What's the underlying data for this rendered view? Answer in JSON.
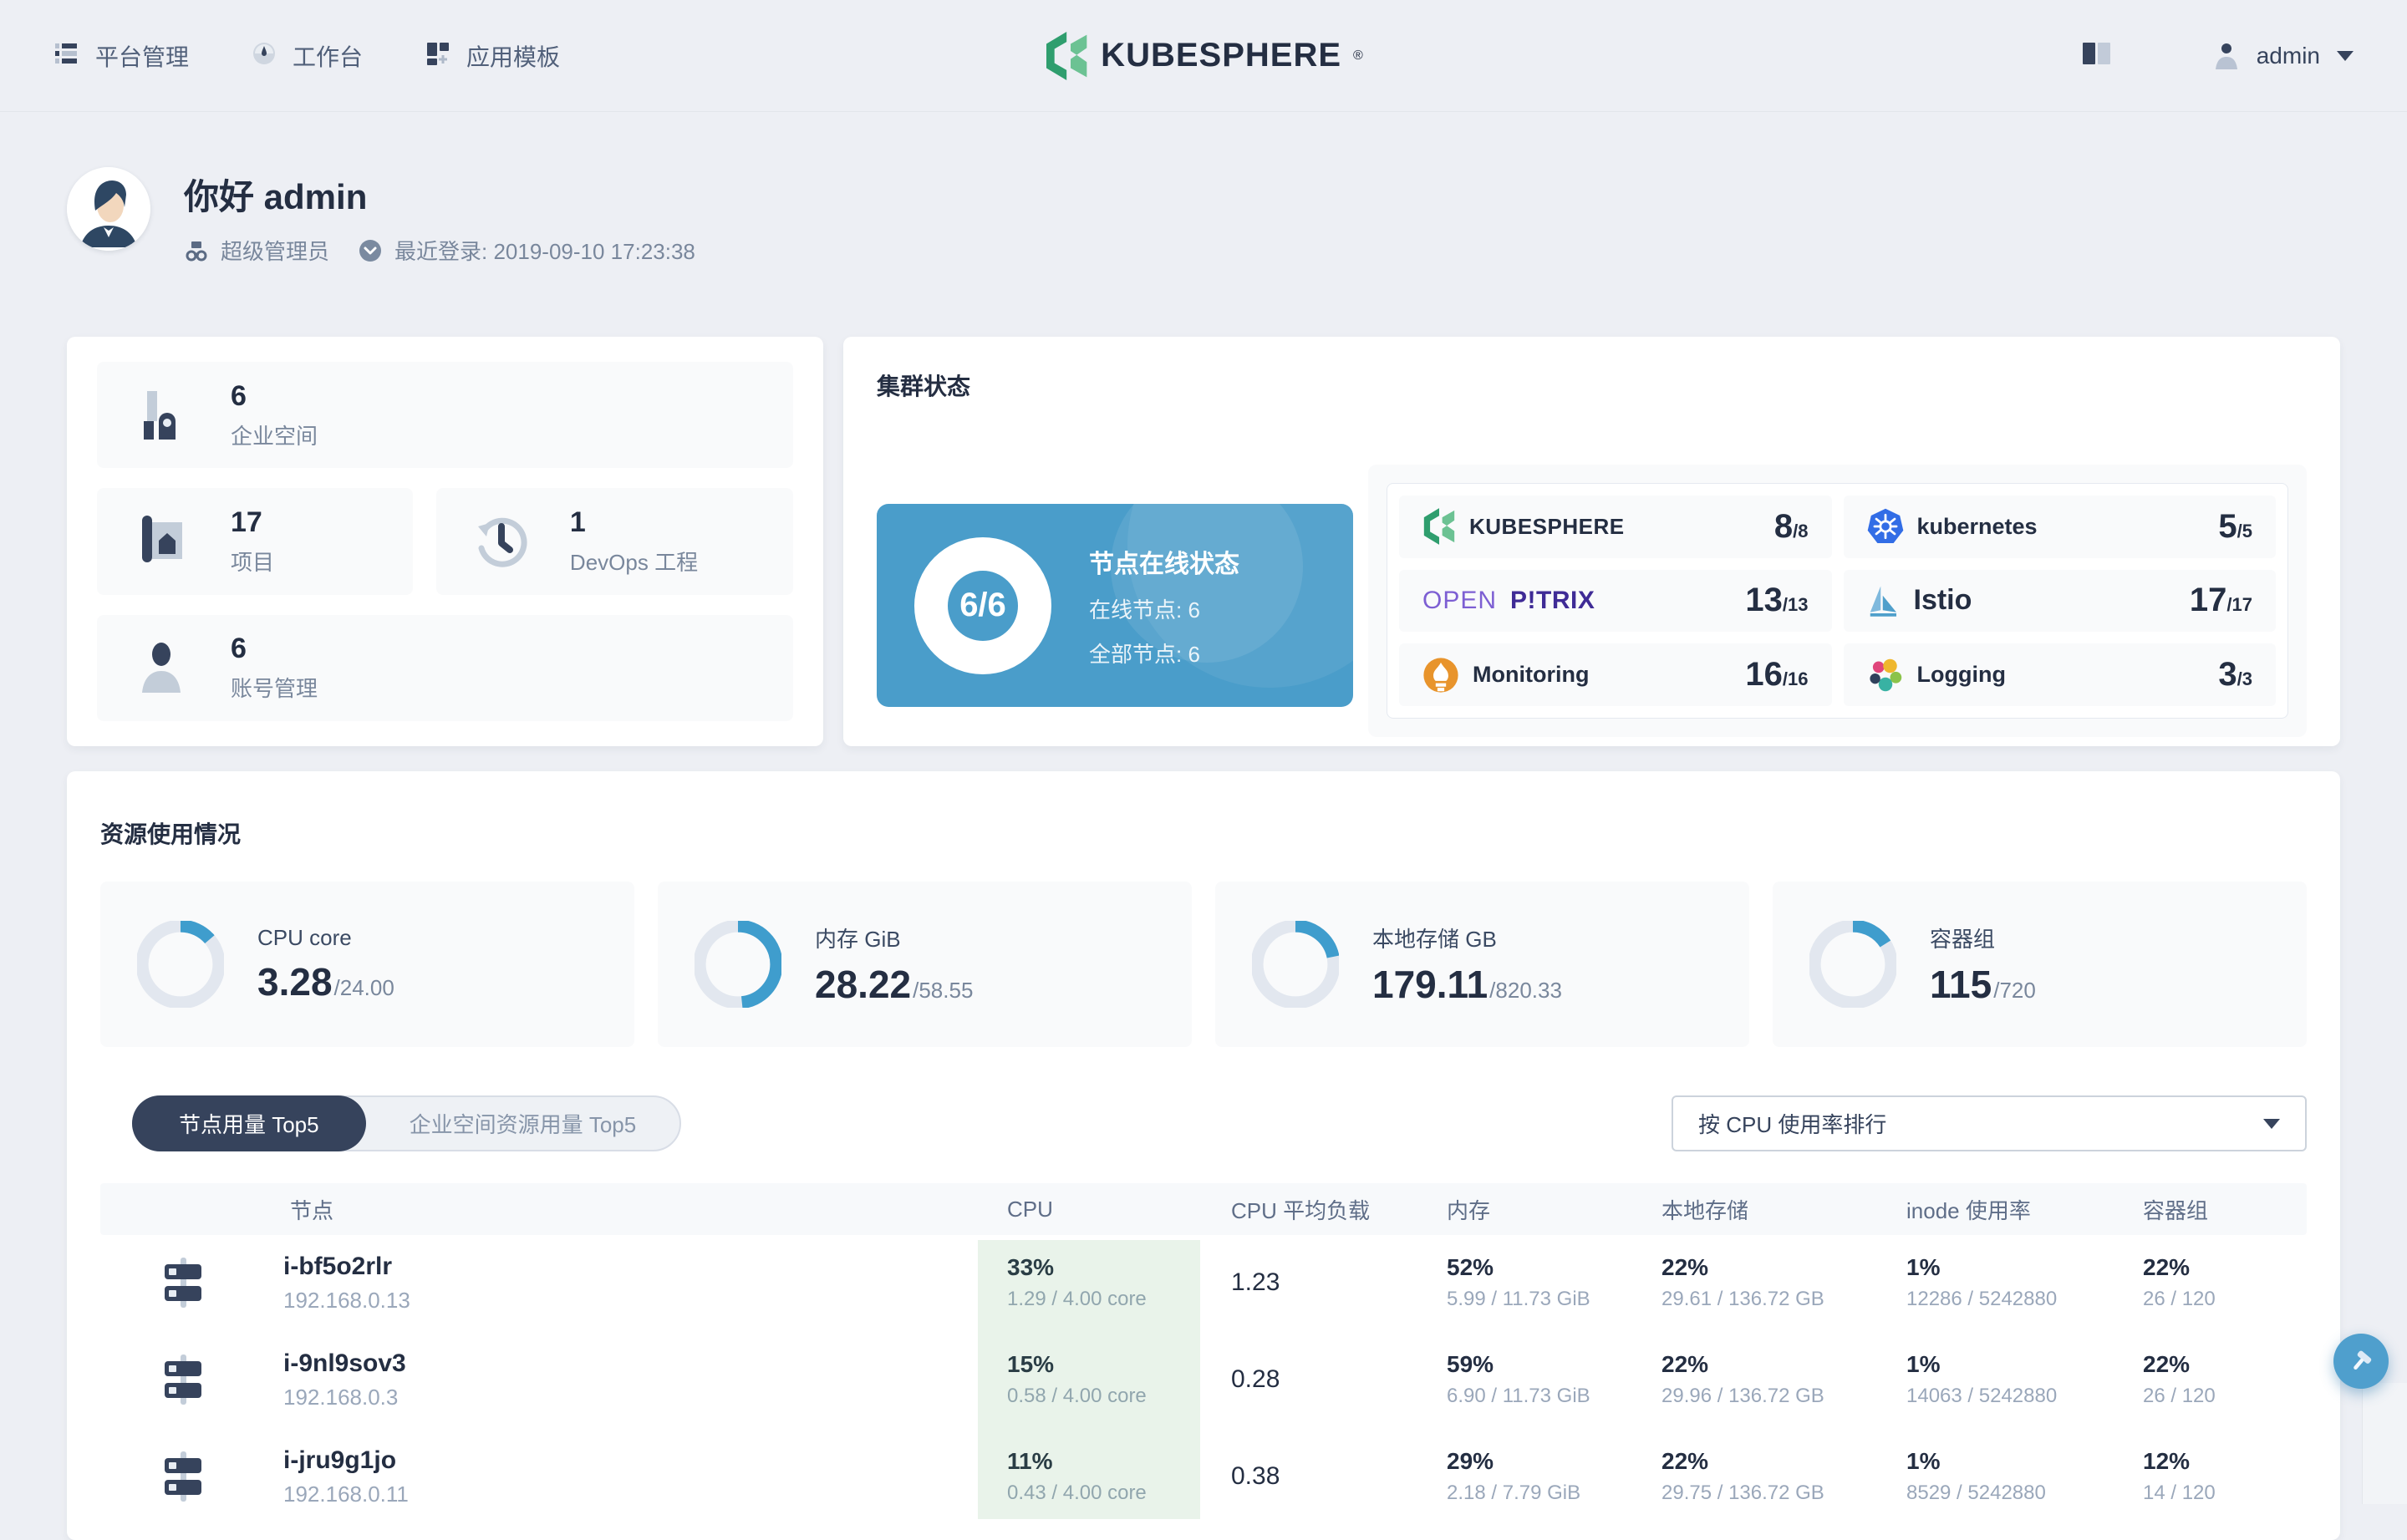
{
  "header": {
    "nav": [
      {
        "label": "平台管理"
      },
      {
        "label": "工作台"
      },
      {
        "label": "应用模板"
      }
    ],
    "logo_text": "KUBESPHERE",
    "logo_reg": "®",
    "user": "admin"
  },
  "greeting": {
    "hello": "你好 admin",
    "role": "超级管理员",
    "last_login": "最近登录: 2019-09-10 17:23:38"
  },
  "stats": {
    "workspaces": {
      "value": "6",
      "label": "企业空间"
    },
    "projects": {
      "value": "17",
      "label": "项目"
    },
    "devops": {
      "value": "1",
      "label": "DevOps 工程"
    },
    "accounts": {
      "value": "6",
      "label": "账号管理"
    }
  },
  "cluster": {
    "title": "集群状态",
    "node_card": {
      "ratio": "6/6",
      "title": "节点在线状态",
      "online": "在线节点: 6",
      "total": "全部节点: 6"
    },
    "components": [
      {
        "name": "KUBESPHERE",
        "used": "8",
        "capacity": "/8"
      },
      {
        "name": "kubernetes",
        "used": "5",
        "capacity": "/5"
      },
      {
        "name_part1": "OPEN",
        "name_part2": "P!TRIX",
        "used": "13",
        "capacity": "/13"
      },
      {
        "name": "Istio",
        "used": "17",
        "capacity": "/17"
      },
      {
        "name": "Monitoring",
        "used": "16",
        "capacity": "/16"
      },
      {
        "name": "Logging",
        "used": "3",
        "capacity": "/3"
      }
    ]
  },
  "resources": {
    "title": "资源使用情况",
    "tiles": [
      {
        "label": "CPU core",
        "used": "3.28",
        "total": "/24.00",
        "percent": 13.7
      },
      {
        "label": "内存 GiB",
        "used": "28.22",
        "total": "/58.55",
        "percent": 48.2
      },
      {
        "label": "本地存储 GB",
        "used": "179.11",
        "total": "/820.33",
        "percent": 21.8
      },
      {
        "label": "容器组",
        "used": "115",
        "total": "/720",
        "percent": 16
      }
    ]
  },
  "toolbar": {
    "tabs": [
      {
        "label": "节点用量 Top5"
      },
      {
        "label": "企业空间资源用量 Top5"
      }
    ],
    "sort_dropdown": "按 CPU 使用率排行"
  },
  "table": {
    "columns": [
      "节点",
      "CPU",
      "CPU 平均负载",
      "内存",
      "本地存储",
      "inode 使用率",
      "容器组"
    ],
    "rows": [
      {
        "name": "i-bf5o2rlr",
        "ip": "192.168.0.13",
        "cpu_pct": "33%",
        "cpu_detail": "1.29 / 4.00 core",
        "load": "1.23",
        "mem_pct": "52%",
        "mem_detail": "5.99 / 11.73 GiB",
        "disk_pct": "22%",
        "disk_detail": "29.61 / 136.72 GB",
        "inode_pct": "1%",
        "inode_detail": "12286 / 5242880",
        "pods_pct": "22%",
        "pods_detail": "26 / 120"
      },
      {
        "name": "i-9nl9sov3",
        "ip": "192.168.0.3",
        "cpu_pct": "15%",
        "cpu_detail": "0.58 / 4.00 core",
        "load": "0.28",
        "mem_pct": "59%",
        "mem_detail": "6.90 / 11.73 GiB",
        "disk_pct": "22%",
        "disk_detail": "29.96 / 136.72 GB",
        "inode_pct": "1%",
        "inode_detail": "14063 / 5242880",
        "pods_pct": "22%",
        "pods_detail": "26 / 120"
      },
      {
        "name": "i-jru9g1jo",
        "ip": "192.168.0.11",
        "cpu_pct": "11%",
        "cpu_detail": "0.43 / 4.00 core",
        "load": "0.38",
        "mem_pct": "29%",
        "mem_detail": "2.18 / 7.79 GiB",
        "disk_pct": "22%",
        "disk_detail": "29.75 / 136.72 GB",
        "inode_pct": "1%",
        "inode_detail": "8529 / 5242880",
        "pods_pct": "12%",
        "pods_detail": "14 / 120"
      }
    ]
  },
  "colors": {
    "primary_blue": "#4a9dca",
    "dark_navy": "#36435c",
    "cpu_column_highlight": "rgba(88,166,92,0.13)",
    "page_background": "#edeff4",
    "kubesphere_green": "#3aa36c"
  }
}
